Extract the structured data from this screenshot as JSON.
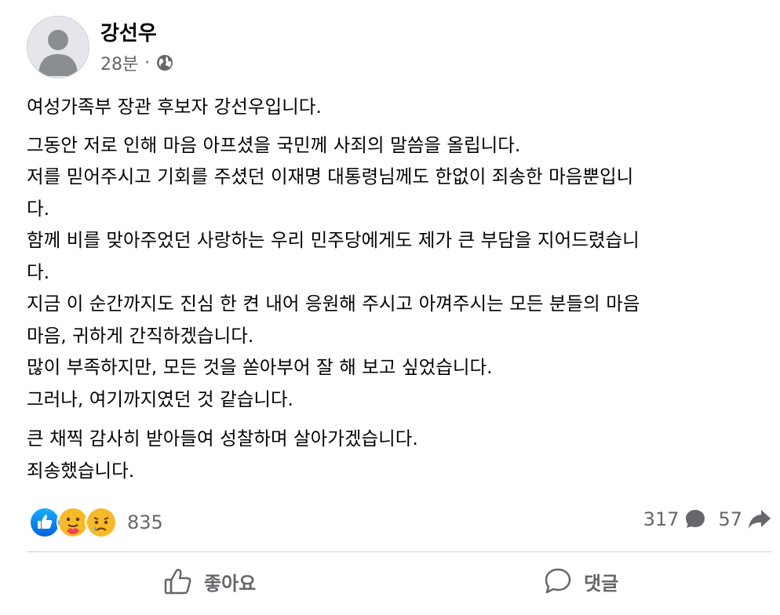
{
  "post": {
    "author": "강선우",
    "time": "28분",
    "separator": "·",
    "privacy_icon": "globe-icon",
    "paragraphs": [
      [
        "여성가족부 장관 후보자 강선우입니다."
      ],
      [
        "그동안 저로 인해 마음 아프셨을 국민께 사죄의 말씀을 올립니다.",
        "저를 믿어주시고 기회를 주셨던 이재명 대통령님께도 한없이 죄송한 마음뿐입니",
        "다.",
        "함께 비를 맞아주었던 사랑하는 우리 민주당에게도 제가 큰 부담을 지어드렸습니",
        "다.",
        "지금 이 순간까지도 진심 한 켠 내어 응원해 주시고 아껴주시는 모든 분들의 마음",
        "마음, 귀하게 간직하겠습니다.",
        "많이 부족하지만, 모든 것을 쏟아부어 잘 해 보고 싶었습니다.",
        "그러나, 여기까지였던 것 같습니다."
      ],
      [
        "큰 채찍 감사히 받아들여 성찰하며 살아가겠습니다.",
        "죄송했습니다."
      ]
    ],
    "reactions": {
      "icons": [
        "like-reaction-icon",
        "care-reaction-icon",
        "sad-reaction-icon"
      ],
      "count": "835"
    },
    "comments_count": "317",
    "shares_count": "57",
    "actions": {
      "like_label": "좋아요",
      "comment_label": "댓글"
    },
    "colors": {
      "like_blue": "#1877f2",
      "reaction_yellow": "#f7b928",
      "secondary_text": "#65676b"
    }
  }
}
